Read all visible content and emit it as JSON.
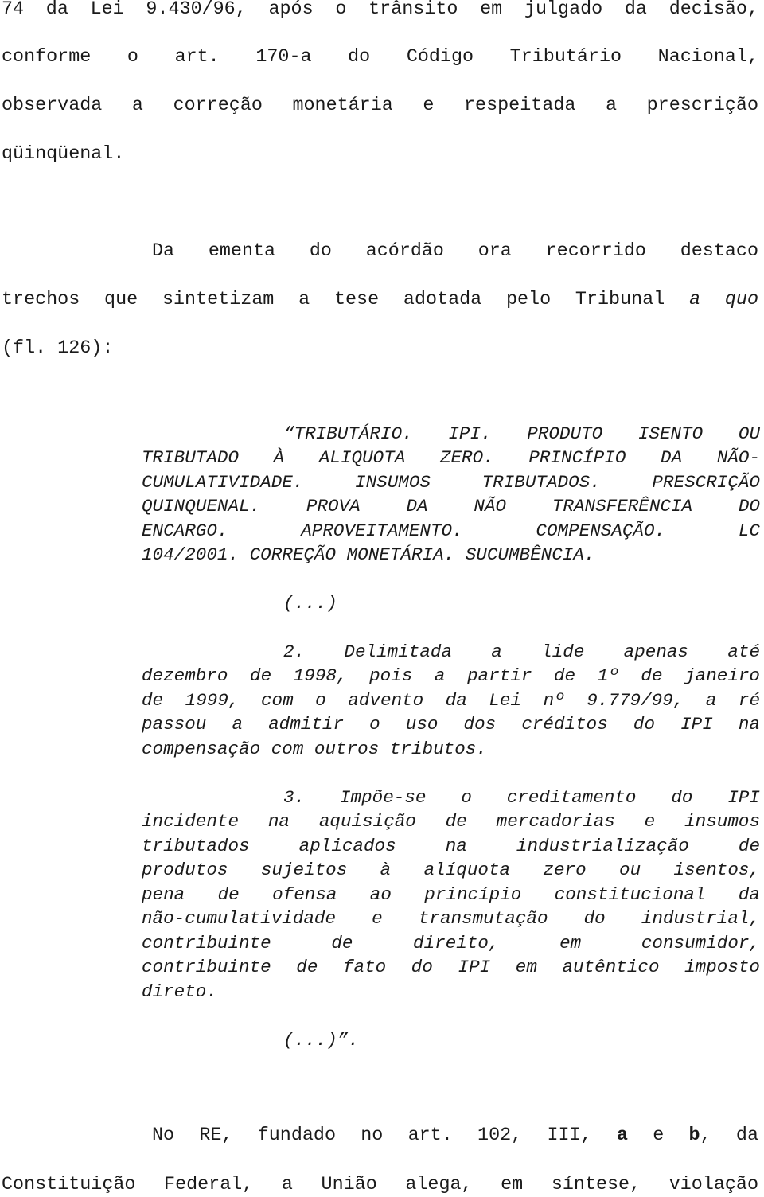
{
  "document": {
    "paragraph_1_lines": [
      "74 da Lei 9.430/96, após o trânsito em julgado da decisão,",
      "conforme o art. 170-a do Código Tributário Nacional,",
      "observada a correção monetária e respeitada a prescrição",
      "qüinqüenal."
    ],
    "paragraph_2": {
      "line_1": "Da ementa do acórdão ora recorrido destaco",
      "line_2_text": "trechos que sintetizam a tese adotada pelo Tribunal",
      "line_2_italic": "a quo",
      "line_3": "(fl. 126):"
    },
    "quote": {
      "heading_lines": [
        "“TRIBUTÁRIO. IPI. PRODUTO ISENTO OU",
        "TRIBUTADO À ALIQUOTA ZERO. PRINCÍPIO DA NÃO-",
        "CUMULATIVIDADE. INSUMOS TRIBUTADOS. PRESCRIÇÃO",
        "QUINQUENAL. PROVA DA NÃO TRANSFERÊNCIA DO",
        "ENCARGO. APROVEITAMENTO. COMPENSAÇÃO. LC",
        "104/2001. CORREÇÃO MONETÁRIA. SUCUMBÊNCIA."
      ],
      "ellipsis_1": "(...)",
      "item_2_lines": [
        "2. Delimitada a lide apenas até",
        "dezembro de 1998, pois a partir de 1º de janeiro",
        "de 1999, com o advento da Lei nº 9.779/99, a ré",
        "passou a admitir o uso dos créditos do IPI na",
        "compensação com outros tributos."
      ],
      "item_3_lines": [
        "3. Impõe-se o creditamento do IPI",
        "incidente na aquisição de mercadorias e insumos",
        "tributados aplicados na industrialização de",
        "produtos sujeitos à alíquota zero ou isentos,",
        "pena de ofensa ao princípio constitucional da",
        "não-cumulatividade e transmutação do industrial,",
        "contribuinte de direito, em consumidor,",
        "contribuinte de fato do IPI em autêntico imposto",
        "direto."
      ],
      "ellipsis_end": "(...)”."
    },
    "paragraph_3": {
      "line_1_prefix": "No RE, fundado no art. 102, III,",
      "bold_a": "a",
      "conj": "e",
      "bold_b": "b",
      "line_1_suffix": ", da",
      "line_2": "Constituição Federal, a União alega, em síntese, violação"
    }
  }
}
